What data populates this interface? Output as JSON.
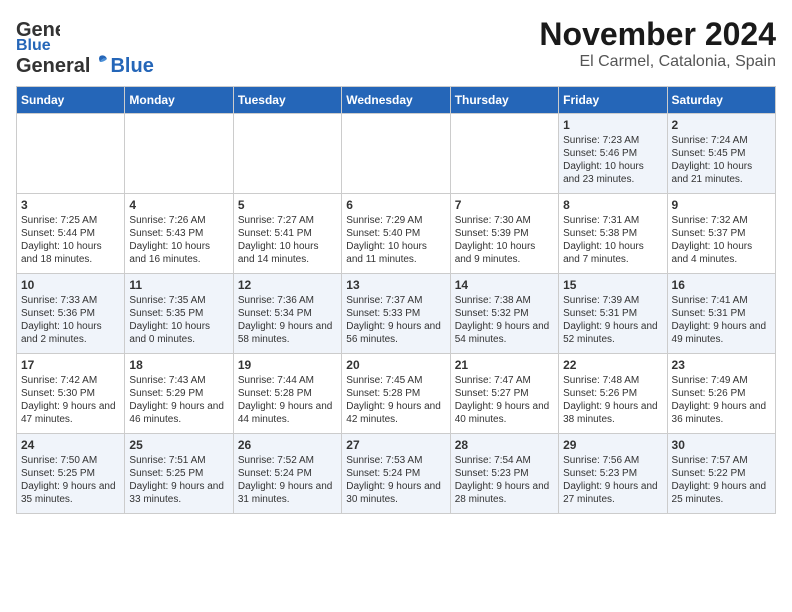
{
  "header": {
    "logo_general": "General",
    "logo_blue": "Blue",
    "month": "November 2024",
    "location": "El Carmel, Catalonia, Spain"
  },
  "days_of_week": [
    "Sunday",
    "Monday",
    "Tuesday",
    "Wednesday",
    "Thursday",
    "Friday",
    "Saturday"
  ],
  "weeks": [
    [
      {
        "day": "",
        "content": ""
      },
      {
        "day": "",
        "content": ""
      },
      {
        "day": "",
        "content": ""
      },
      {
        "day": "",
        "content": ""
      },
      {
        "day": "",
        "content": ""
      },
      {
        "day": "1",
        "content": "Sunrise: 7:23 AM\nSunset: 5:46 PM\nDaylight: 10 hours and 23 minutes."
      },
      {
        "day": "2",
        "content": "Sunrise: 7:24 AM\nSunset: 5:45 PM\nDaylight: 10 hours and 21 minutes."
      }
    ],
    [
      {
        "day": "3",
        "content": "Sunrise: 7:25 AM\nSunset: 5:44 PM\nDaylight: 10 hours and 18 minutes."
      },
      {
        "day": "4",
        "content": "Sunrise: 7:26 AM\nSunset: 5:43 PM\nDaylight: 10 hours and 16 minutes."
      },
      {
        "day": "5",
        "content": "Sunrise: 7:27 AM\nSunset: 5:41 PM\nDaylight: 10 hours and 14 minutes."
      },
      {
        "day": "6",
        "content": "Sunrise: 7:29 AM\nSunset: 5:40 PM\nDaylight: 10 hours and 11 minutes."
      },
      {
        "day": "7",
        "content": "Sunrise: 7:30 AM\nSunset: 5:39 PM\nDaylight: 10 hours and 9 minutes."
      },
      {
        "day": "8",
        "content": "Sunrise: 7:31 AM\nSunset: 5:38 PM\nDaylight: 10 hours and 7 minutes."
      },
      {
        "day": "9",
        "content": "Sunrise: 7:32 AM\nSunset: 5:37 PM\nDaylight: 10 hours and 4 minutes."
      }
    ],
    [
      {
        "day": "10",
        "content": "Sunrise: 7:33 AM\nSunset: 5:36 PM\nDaylight: 10 hours and 2 minutes."
      },
      {
        "day": "11",
        "content": "Sunrise: 7:35 AM\nSunset: 5:35 PM\nDaylight: 10 hours and 0 minutes."
      },
      {
        "day": "12",
        "content": "Sunrise: 7:36 AM\nSunset: 5:34 PM\nDaylight: 9 hours and 58 minutes."
      },
      {
        "day": "13",
        "content": "Sunrise: 7:37 AM\nSunset: 5:33 PM\nDaylight: 9 hours and 56 minutes."
      },
      {
        "day": "14",
        "content": "Sunrise: 7:38 AM\nSunset: 5:32 PM\nDaylight: 9 hours and 54 minutes."
      },
      {
        "day": "15",
        "content": "Sunrise: 7:39 AM\nSunset: 5:31 PM\nDaylight: 9 hours and 52 minutes."
      },
      {
        "day": "16",
        "content": "Sunrise: 7:41 AM\nSunset: 5:31 PM\nDaylight: 9 hours and 49 minutes."
      }
    ],
    [
      {
        "day": "17",
        "content": "Sunrise: 7:42 AM\nSunset: 5:30 PM\nDaylight: 9 hours and 47 minutes."
      },
      {
        "day": "18",
        "content": "Sunrise: 7:43 AM\nSunset: 5:29 PM\nDaylight: 9 hours and 46 minutes."
      },
      {
        "day": "19",
        "content": "Sunrise: 7:44 AM\nSunset: 5:28 PM\nDaylight: 9 hours and 44 minutes."
      },
      {
        "day": "20",
        "content": "Sunrise: 7:45 AM\nSunset: 5:28 PM\nDaylight: 9 hours and 42 minutes."
      },
      {
        "day": "21",
        "content": "Sunrise: 7:47 AM\nSunset: 5:27 PM\nDaylight: 9 hours and 40 minutes."
      },
      {
        "day": "22",
        "content": "Sunrise: 7:48 AM\nSunset: 5:26 PM\nDaylight: 9 hours and 38 minutes."
      },
      {
        "day": "23",
        "content": "Sunrise: 7:49 AM\nSunset: 5:26 PM\nDaylight: 9 hours and 36 minutes."
      }
    ],
    [
      {
        "day": "24",
        "content": "Sunrise: 7:50 AM\nSunset: 5:25 PM\nDaylight: 9 hours and 35 minutes."
      },
      {
        "day": "25",
        "content": "Sunrise: 7:51 AM\nSunset: 5:25 PM\nDaylight: 9 hours and 33 minutes."
      },
      {
        "day": "26",
        "content": "Sunrise: 7:52 AM\nSunset: 5:24 PM\nDaylight: 9 hours and 31 minutes."
      },
      {
        "day": "27",
        "content": "Sunrise: 7:53 AM\nSunset: 5:24 PM\nDaylight: 9 hours and 30 minutes."
      },
      {
        "day": "28",
        "content": "Sunrise: 7:54 AM\nSunset: 5:23 PM\nDaylight: 9 hours and 28 minutes."
      },
      {
        "day": "29",
        "content": "Sunrise: 7:56 AM\nSunset: 5:23 PM\nDaylight: 9 hours and 27 minutes."
      },
      {
        "day": "30",
        "content": "Sunrise: 7:57 AM\nSunset: 5:22 PM\nDaylight: 9 hours and 25 minutes."
      }
    ]
  ]
}
